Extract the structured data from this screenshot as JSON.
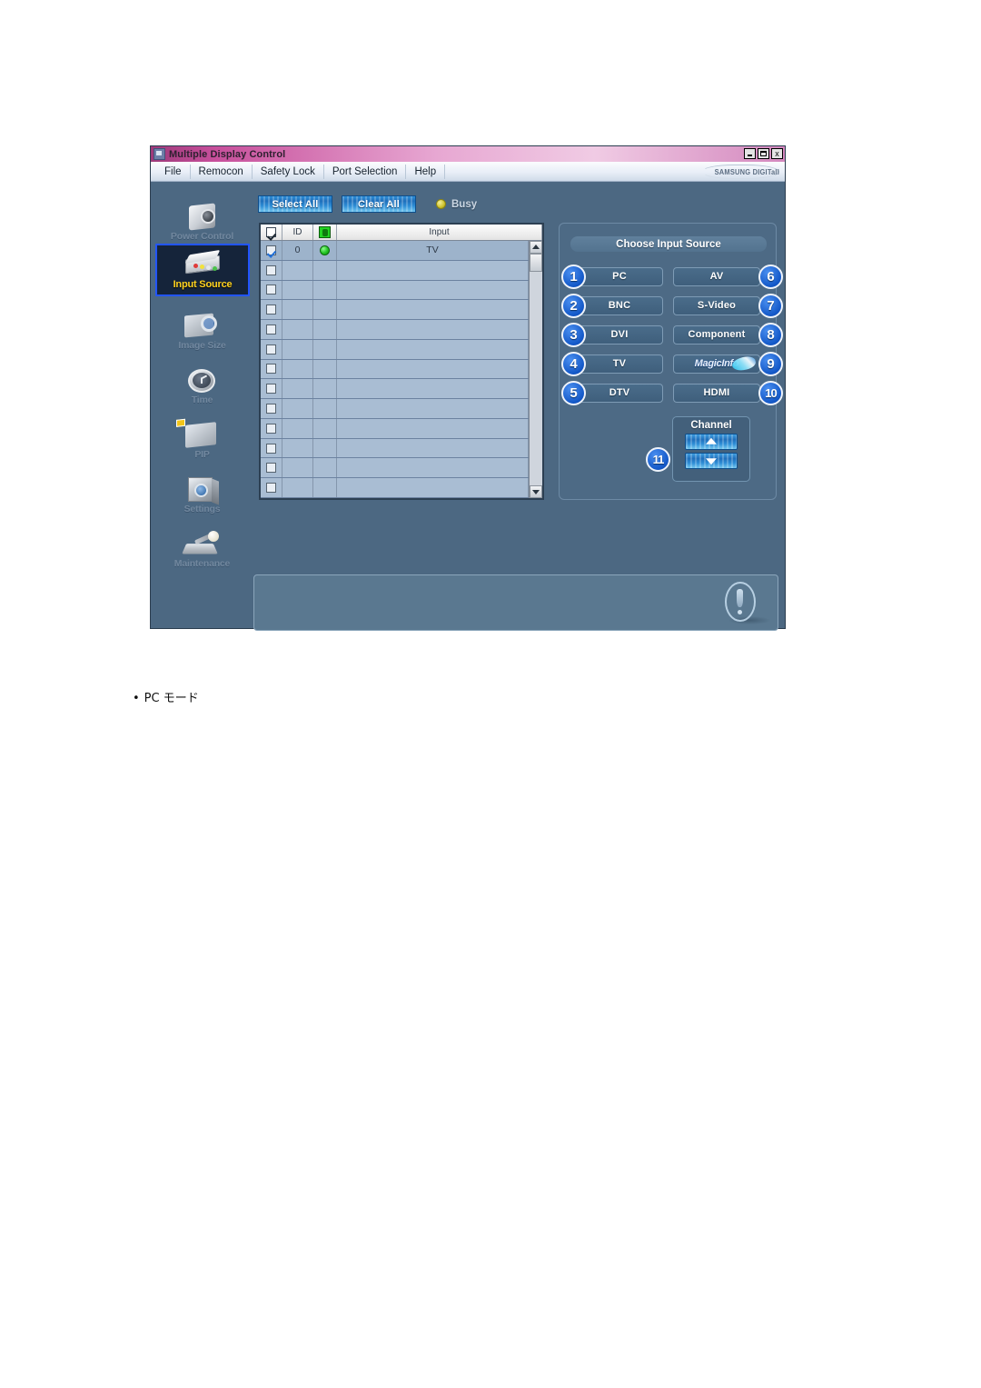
{
  "window": {
    "title": "Multiple Display Control",
    "title_icon": "app-monitor-icon",
    "controls": {
      "minimize": "_",
      "maximize": "□",
      "close": "x"
    }
  },
  "menu": {
    "items": [
      {
        "label": "File"
      },
      {
        "label": "Remocon"
      },
      {
        "label": "Safety Lock"
      },
      {
        "label": "Port Selection"
      },
      {
        "label": "Help"
      }
    ],
    "brand_logo": "SAMSUNG DIGITall"
  },
  "sidebar": {
    "items": [
      {
        "label": "Power Control",
        "icon": "power-control-icon",
        "selected": false
      },
      {
        "label": "Input Source",
        "icon": "input-source-icon",
        "selected": true
      },
      {
        "label": "Image Size",
        "icon": "image-size-icon",
        "selected": false
      },
      {
        "label": "Time",
        "icon": "time-clock-icon",
        "selected": false
      },
      {
        "label": "PIP",
        "icon": "pip-icon",
        "selected": false
      },
      {
        "label": "Settings",
        "icon": "settings-cube-icon",
        "selected": false
      },
      {
        "label": "Maintenance",
        "icon": "maintenance-icon",
        "selected": false
      }
    ]
  },
  "toolbar": {
    "select_all_label": "Select All",
    "clear_all_label": "Clear All",
    "status_label": "Busy",
    "status_icon": "busy-dot-icon",
    "status_color": "#cfc32e"
  },
  "table": {
    "columns": [
      {
        "key": "check",
        "label": "",
        "icon": "header-checkbox-icon"
      },
      {
        "key": "id",
        "label": "ID"
      },
      {
        "key": "power",
        "label": "",
        "icon": "power-status-icon"
      },
      {
        "key": "input",
        "label": "Input"
      }
    ],
    "rows": [
      {
        "checked": true,
        "id": "0",
        "power": true,
        "input": "TV"
      },
      {
        "checked": false,
        "id": "",
        "power": false,
        "input": ""
      },
      {
        "checked": false,
        "id": "",
        "power": false,
        "input": ""
      },
      {
        "checked": false,
        "id": "",
        "power": false,
        "input": ""
      },
      {
        "checked": false,
        "id": "",
        "power": false,
        "input": ""
      },
      {
        "checked": false,
        "id": "",
        "power": false,
        "input": ""
      },
      {
        "checked": false,
        "id": "",
        "power": false,
        "input": ""
      },
      {
        "checked": false,
        "id": "",
        "power": false,
        "input": ""
      },
      {
        "checked": false,
        "id": "",
        "power": false,
        "input": ""
      },
      {
        "checked": false,
        "id": "",
        "power": false,
        "input": ""
      },
      {
        "checked": false,
        "id": "",
        "power": false,
        "input": ""
      },
      {
        "checked": false,
        "id": "",
        "power": false,
        "input": ""
      },
      {
        "checked": false,
        "id": "",
        "power": false,
        "input": ""
      }
    ],
    "scrollbar": {
      "up_icon": "scroll-up-arrow-icon",
      "down_icon": "scroll-down-arrow-icon"
    }
  },
  "source_panel": {
    "title": "Choose Input Source",
    "buttons": [
      {
        "badge": "1",
        "label": "PC"
      },
      {
        "badge": "6",
        "label": "AV"
      },
      {
        "badge": "2",
        "label": "BNC"
      },
      {
        "badge": "7",
        "label": "S-Video"
      },
      {
        "badge": "3",
        "label": "DVI"
      },
      {
        "badge": "8",
        "label": "Component"
      },
      {
        "badge": "4",
        "label": "TV"
      },
      {
        "badge": "9",
        "label": "MagicInfo"
      },
      {
        "badge": "5",
        "label": "DTV"
      },
      {
        "badge": "10",
        "label": "HDMI"
      }
    ],
    "channel": {
      "label": "Channel",
      "badge": "11",
      "up_icon": "channel-up-arrow-icon",
      "down_icon": "channel-down-arrow-icon"
    },
    "badge_color": "#1358c8"
  },
  "status_bar": {
    "message": "",
    "icon": "exclamation-info-icon"
  },
  "caption": {
    "bullet": "•",
    "text": "PC モード"
  }
}
